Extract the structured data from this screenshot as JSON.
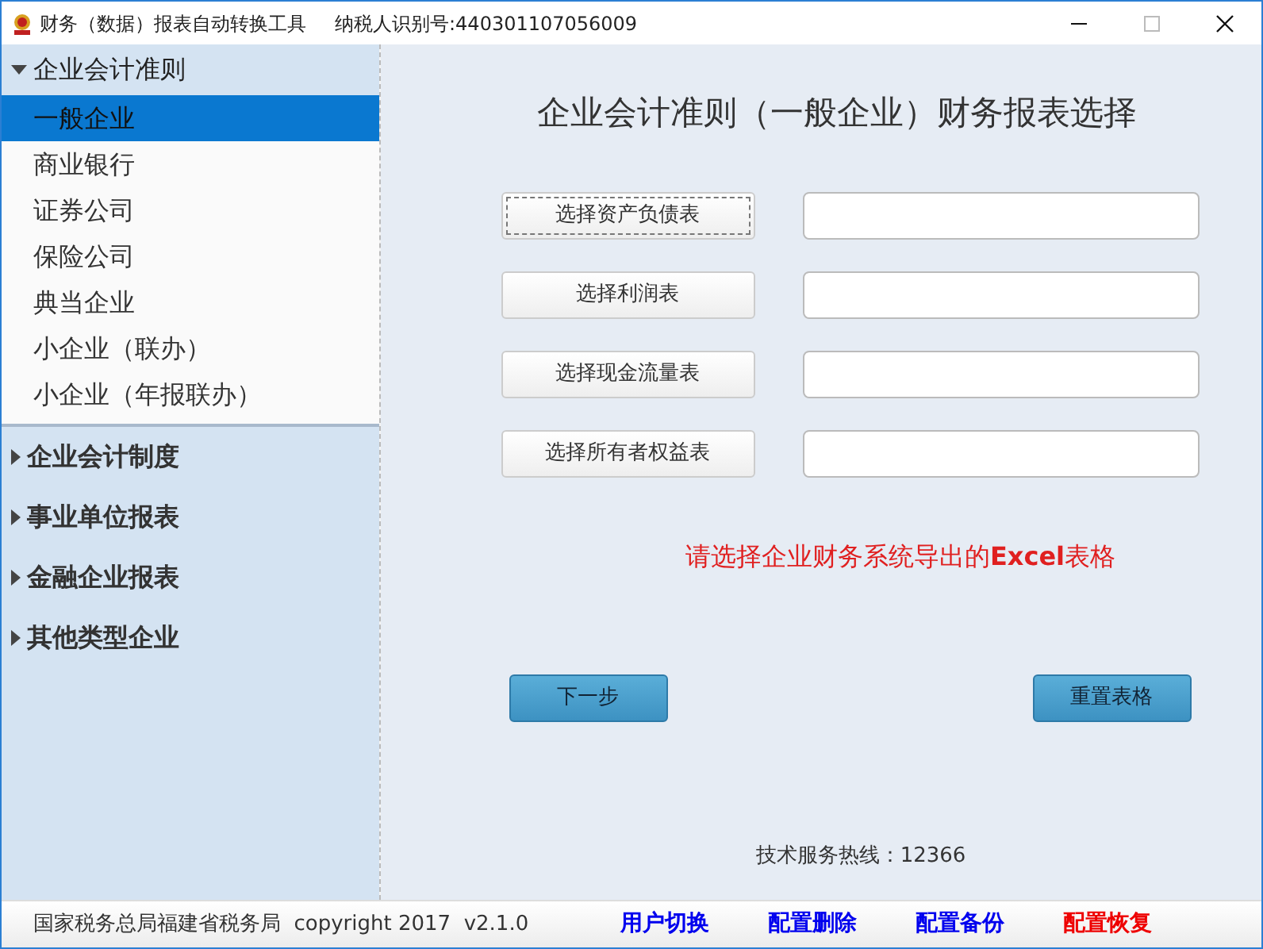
{
  "window": {
    "title": "财务（数据）报表自动转换工具",
    "taxpayer_id": "纳税人识别号:440301107056009",
    "buttons": [
      {
        "kind": "minimize",
        "disabled": false
      },
      {
        "kind": "maximize",
        "disabled": true
      },
      {
        "kind": "close",
        "disabled": false
      }
    ]
  },
  "sidebar": {
    "groups": [
      {
        "label": "企业会计准则",
        "expanded": true,
        "items": [
          {
            "label": "一般企业",
            "selected": true
          },
          {
            "label": "商业银行",
            "selected": false
          },
          {
            "label": "证券公司",
            "selected": false
          },
          {
            "label": "保险公司",
            "selected": false
          },
          {
            "label": "典当企业",
            "selected": false
          },
          {
            "label": "小企业（联办）",
            "selected": false
          },
          {
            "label": "小企业（年报联办）",
            "selected": false
          }
        ]
      },
      {
        "label": "企业会计制度",
        "expanded": false
      },
      {
        "label": "事业单位报表",
        "expanded": false
      },
      {
        "label": "金融企业报表",
        "expanded": false
      },
      {
        "label": "其他类型企业",
        "expanded": false
      }
    ]
  },
  "main": {
    "heading": "企业会计准则（一般企业）财务报表选择",
    "pickers": [
      {
        "button": "选择资产负债表",
        "focused": true
      },
      {
        "button": "选择利润表",
        "focused": false
      },
      {
        "button": "选择现金流量表",
        "focused": false
      },
      {
        "button": "选择所有者权益表",
        "focused": false
      }
    ],
    "hint": "请选择企业财务系统导出的**Excel**表格",
    "actions": [
      "下一步",
      "重置表格"
    ],
    "hotline": "技术服务热线：12366"
  },
  "status_bar": {
    "text": "国家税务总局福建省税务局  copyright 2017  v2.1.0",
    "links": [
      {
        "label": "用户切换",
        "color": "#0000ee"
      },
      {
        "label": "配置删除",
        "color": "#0000ee"
      },
      {
        "label": "配置备份",
        "color": "#0000ee"
      },
      {
        "label": "配置恢复",
        "color": "#ee0000"
      }
    ]
  }
}
